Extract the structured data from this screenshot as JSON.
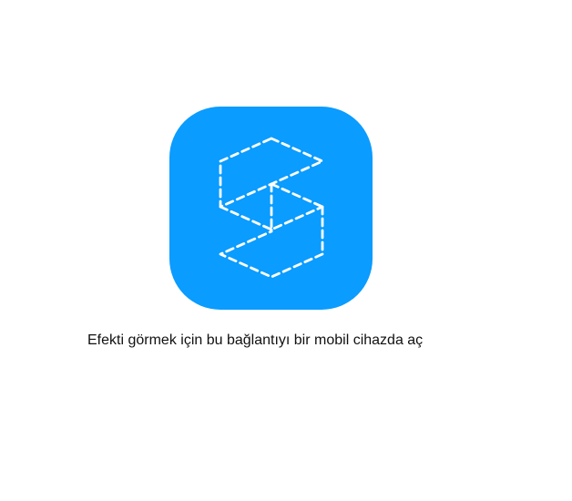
{
  "app": {
    "icon_name": "dashed-s-logo-icon",
    "icon_color": "#0a9cff",
    "line_color": "#ffffff"
  },
  "message": {
    "text": "Efekti görmek için bu bağlantıyı bir mobil cihazda aç"
  }
}
